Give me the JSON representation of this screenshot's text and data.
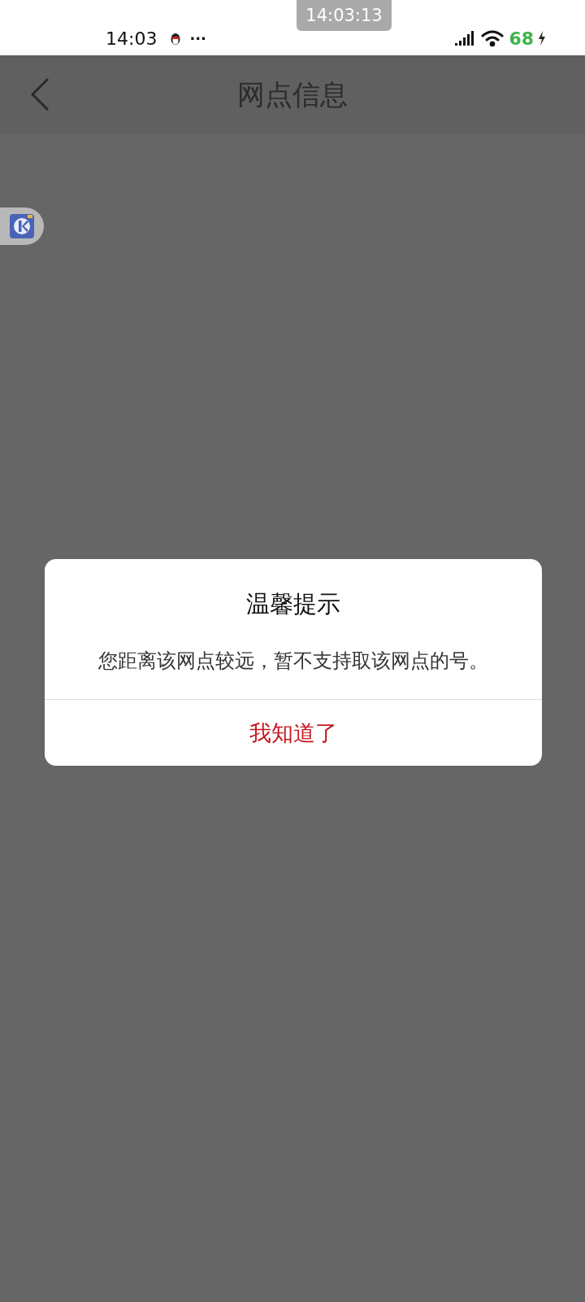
{
  "status_bar": {
    "screenshot_time": "14:03:13",
    "time": "14:03",
    "more": "···",
    "battery": "68"
  },
  "nav_bar": {
    "title": "网点信息"
  },
  "dialog": {
    "title": "温馨提示",
    "message": "您距离该网点较远，暂不支持取该网点的号。",
    "button": "我知道了"
  }
}
